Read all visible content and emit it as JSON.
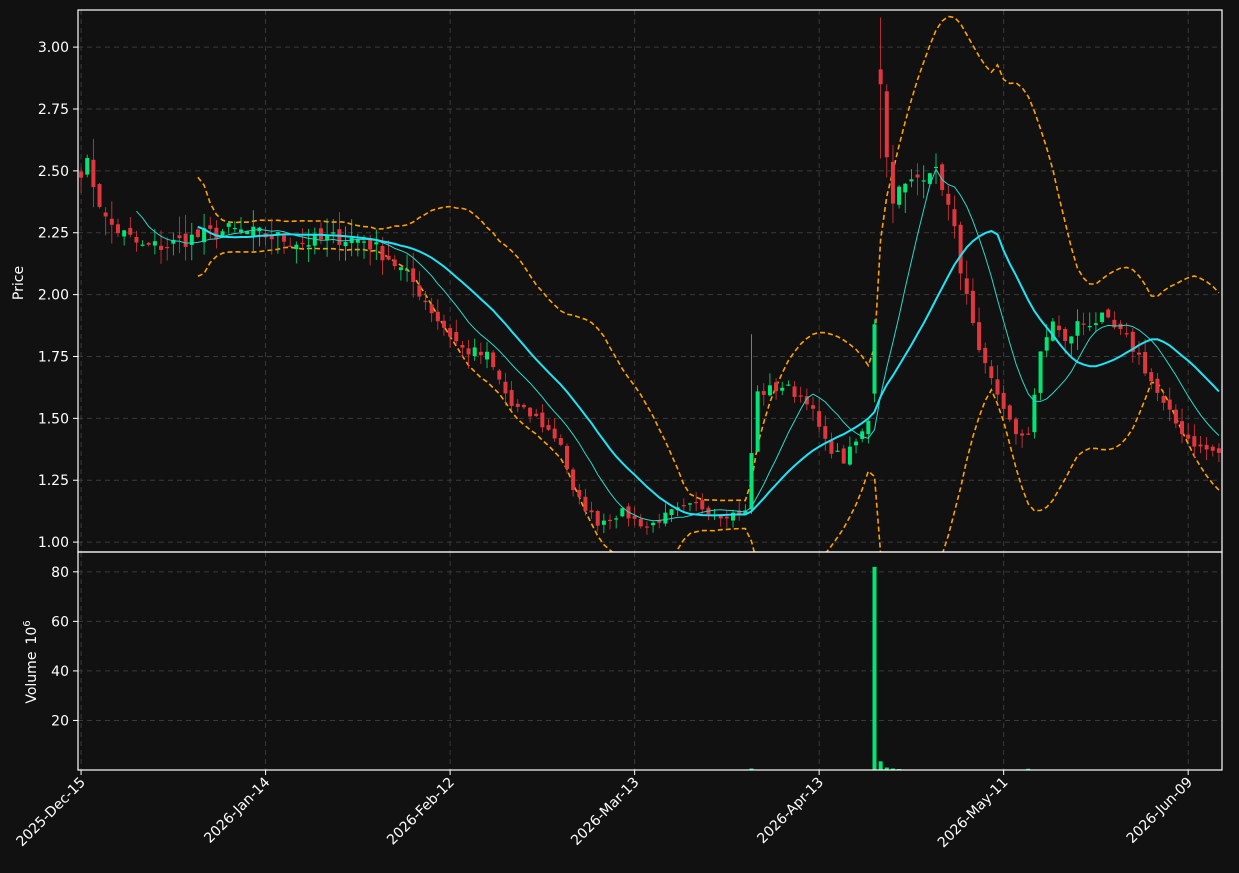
{
  "chart_data": {
    "type": "candlestick",
    "x_axis": {
      "tick_labels": [
        "2025-Dec-15",
        "2026-Jan-14",
        "2026-Feb-12",
        "2026-Mar-13",
        "2026-Apr-13",
        "2026-May-11",
        "2026-Jun-09"
      ],
      "tick_positions": [
        0,
        30,
        60,
        90,
        120,
        150,
        180
      ],
      "range": [
        -0.5,
        185.5
      ]
    },
    "price_panel": {
      "ylabel": "Price",
      "ylim": [
        0.96,
        3.15
      ],
      "yticks": [
        1.0,
        1.25,
        1.5,
        1.75,
        2.0,
        2.25,
        2.5,
        2.75,
        3.0
      ],
      "ytick_labels": [
        "1.00",
        "1.25",
        "1.50",
        "1.75",
        "2.00",
        "2.25",
        "2.50",
        "2.75",
        "3.00"
      ]
    },
    "volume_panel": {
      "ylabel": "Volume",
      "ylabel_exponent": "10",
      "ylabel_exponent_power": "6",
      "ylim": [
        0,
        88
      ],
      "yticks": [
        20,
        40,
        60,
        80
      ],
      "ytick_labels": [
        "20",
        "40",
        "60",
        "80"
      ]
    },
    "colors": {
      "up": "#00e676",
      "down": "#e0373f",
      "bollinger": "#ffa000",
      "ma_fast": "#26d8c8",
      "ma_slow": "#1ee4f5",
      "volume": "#00e676",
      "background": "#111111",
      "grid": "#3a3a3a",
      "text": "#ffffff"
    },
    "grid": true,
    "price_anchors": [
      [
        0,
        2.51
      ],
      [
        1,
        2.52
      ],
      [
        2,
        2.45
      ],
      [
        4,
        2.3
      ],
      [
        6,
        2.26
      ],
      [
        10,
        2.19
      ],
      [
        14,
        2.2
      ],
      [
        18,
        2.23
      ],
      [
        24,
        2.26
      ],
      [
        30,
        2.24
      ],
      [
        36,
        2.21
      ],
      [
        42,
        2.23
      ],
      [
        46,
        2.22
      ],
      [
        50,
        2.15
      ],
      [
        54,
        2.05
      ],
      [
        58,
        1.9
      ],
      [
        62,
        1.78
      ],
      [
        66,
        1.75
      ],
      [
        70,
        1.55
      ],
      [
        74,
        1.5
      ],
      [
        78,
        1.4
      ],
      [
        80,
        1.2
      ],
      [
        84,
        1.08
      ],
      [
        88,
        1.12
      ],
      [
        92,
        1.06
      ],
      [
        96,
        1.12
      ],
      [
        100,
        1.15
      ],
      [
        104,
        1.11
      ],
      [
        108,
        1.12
      ],
      [
        110,
        1.6
      ],
      [
        114,
        1.63
      ],
      [
        118,
        1.58
      ],
      [
        121,
        1.4
      ],
      [
        124,
        1.33
      ],
      [
        127,
        1.44
      ],
      [
        128,
        1.5
      ],
      [
        129,
        1.65
      ],
      [
        130,
        2.88
      ],
      [
        131,
        2.55
      ],
      [
        132,
        2.4
      ],
      [
        135,
        2.45
      ],
      [
        138,
        2.52
      ],
      [
        140,
        2.45
      ],
      [
        142,
        2.25
      ],
      [
        144,
        1.98
      ],
      [
        146,
        1.75
      ],
      [
        148,
        1.65
      ],
      [
        150,
        1.55
      ],
      [
        152,
        1.42
      ],
      [
        154,
        1.45
      ],
      [
        156,
        1.75
      ],
      [
        158,
        1.9
      ],
      [
        160,
        1.8
      ],
      [
        162,
        1.88
      ],
      [
        166,
        1.9
      ],
      [
        170,
        1.82
      ],
      [
        172,
        1.75
      ],
      [
        174,
        1.65
      ],
      [
        176,
        1.55
      ],
      [
        178,
        1.48
      ],
      [
        180,
        1.42
      ],
      [
        182,
        1.38
      ],
      [
        185,
        1.36
      ]
    ],
    "volume_events": [
      [
        129,
        82.0
      ],
      [
        130,
        3.5
      ],
      [
        131,
        1.0
      ],
      [
        132,
        0.6
      ],
      [
        133,
        0.4
      ],
      [
        109,
        0.6
      ],
      [
        154,
        0.5
      ]
    ],
    "volume_base": 0.15,
    "ma_fast_window": 10,
    "ma_slow_window": 20,
    "bollinger_window": 20,
    "bollinger_k": 2
  }
}
